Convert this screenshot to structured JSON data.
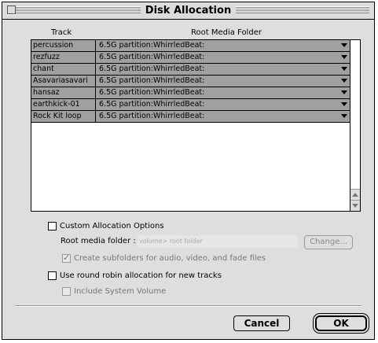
{
  "window": {
    "title": "Disk Allocation"
  },
  "table": {
    "col_track": "Track",
    "col_folder": "Root Media Folder",
    "rows": [
      {
        "track": "percussion",
        "folder": "6.5G partition:WhirrledBeat:"
      },
      {
        "track": "rezfuzz",
        "folder": "6.5G partition:WhirrledBeat:"
      },
      {
        "track": "chant",
        "folder": "6.5G partition:WhirrledBeat:"
      },
      {
        "track": "Asavariasavari",
        "folder": "6.5G partition:WhirrledBeat:"
      },
      {
        "track": "hansaz",
        "folder": "6.5G partition:WhirrledBeat:"
      },
      {
        "track": "earthkick-01",
        "folder": "6.5G partition:WhirrledBeat:"
      },
      {
        "track": "Rock Kit loop",
        "folder": "6.5G partition:WhirrledBeat:"
      }
    ]
  },
  "options": {
    "custom_allocation": "Custom Allocation Options",
    "root_media_folder_label": "Root media folder :",
    "root_media_folder_value": "volume> root folder",
    "change_button": "Change...",
    "create_subfolders": "Create subfolders for audio, video, and fade files",
    "round_robin": "Use round robin allocation for new tracks",
    "include_system_volume": "Include System Volume"
  },
  "buttons": {
    "cancel": "Cancel",
    "ok": "OK"
  }
}
